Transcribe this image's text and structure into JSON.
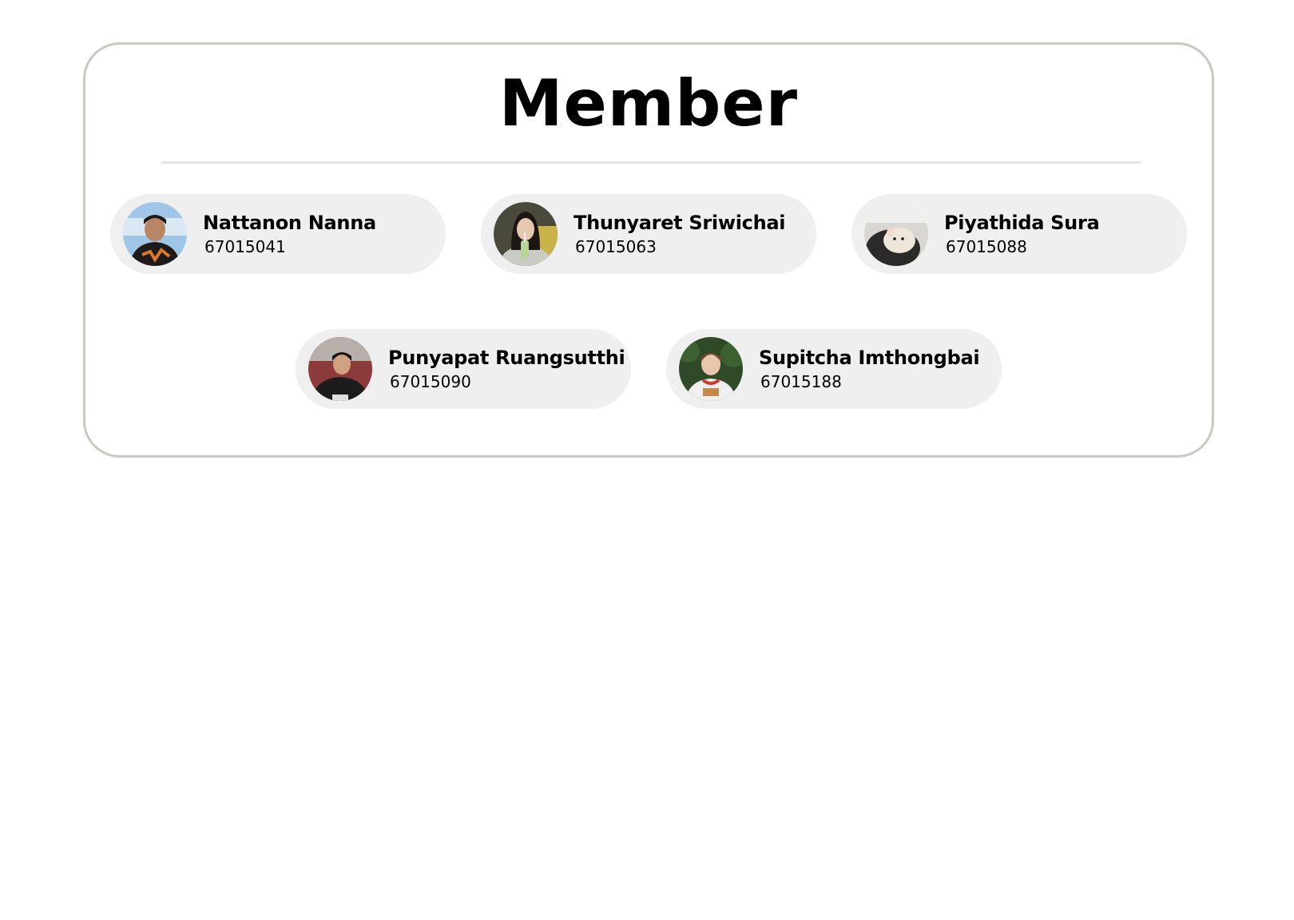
{
  "page": {
    "title": "Member"
  },
  "members": [
    {
      "name": "Nattanon Nanna",
      "id": "67015041",
      "avatar_icon": "person-photo"
    },
    {
      "name": "Thunyaret Sriwichai",
      "id": "67015063",
      "avatar_icon": "person-photo"
    },
    {
      "name": "Piyathida Sura",
      "id": "67015088",
      "avatar_icon": "hamster-photo"
    },
    {
      "name": "Punyapat Ruangsutthi",
      "id": "67015090",
      "avatar_icon": "person-photo"
    },
    {
      "name": "Supitcha Imthongbai",
      "id": "67015188",
      "avatar_icon": "person-photo"
    }
  ],
  "colors": {
    "panel_border": "#c9c9c1",
    "card_background": "#efefef",
    "divider": "#e4e4e4"
  }
}
